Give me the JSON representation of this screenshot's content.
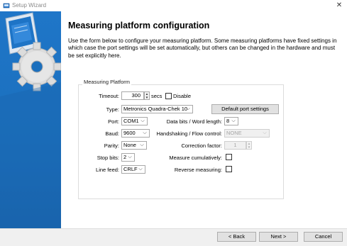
{
  "window": {
    "title": "Setup Wizard",
    "close_glyph": "✕",
    "icon": "setup-wizard-icon"
  },
  "page": {
    "heading": "Measuring platform configuration",
    "intro": "Use the form below to configure your measuring platform.  Some measuring platforms have fixed settings in which case the port settings will be set automatically, but others can be changed in the hardware and must be set explicitly here."
  },
  "group": {
    "label": "Measuring Platform",
    "timeout": {
      "label": "Timeout:",
      "value": "300",
      "unit": "secs"
    },
    "disable": {
      "label": "Disable",
      "checked": false
    },
    "type": {
      "label": "Type:",
      "value": "Metronics Quadra-Chek 10"
    },
    "default_port_button": "Default port settings",
    "port": {
      "label": "Port:",
      "value": "COM1"
    },
    "baud": {
      "label": "Baud:",
      "value": "9600"
    },
    "parity": {
      "label": "Parity:",
      "value": "None"
    },
    "stop_bits": {
      "label": "Stop bits:",
      "value": "2"
    },
    "line_feed": {
      "label": "Line feed:",
      "value": "CRLF"
    },
    "data_bits": {
      "label": "Data bits / Word length:",
      "value": "8"
    },
    "handshaking": {
      "label": "Handshaking / Flow control:",
      "value": "NONE",
      "disabled": true
    },
    "correction_factor": {
      "label": "Correction factor:",
      "value": "1",
      "disabled": true
    },
    "measure_cumulatively": {
      "label": "Measure cumulatively:",
      "checked": false
    },
    "reverse_measuring": {
      "label": "Reverse measuring:",
      "checked": false
    }
  },
  "icons": {
    "spin_up": "▲",
    "spin_down": "▼",
    "dropdown": "⌵"
  },
  "footer": {
    "back": "< Back",
    "next": "Next >",
    "cancel": "Cancel"
  },
  "colors": {
    "sidebar": "#1b6fbd",
    "footer": "#f0f0f0",
    "button_face": "#e1e1e1"
  }
}
